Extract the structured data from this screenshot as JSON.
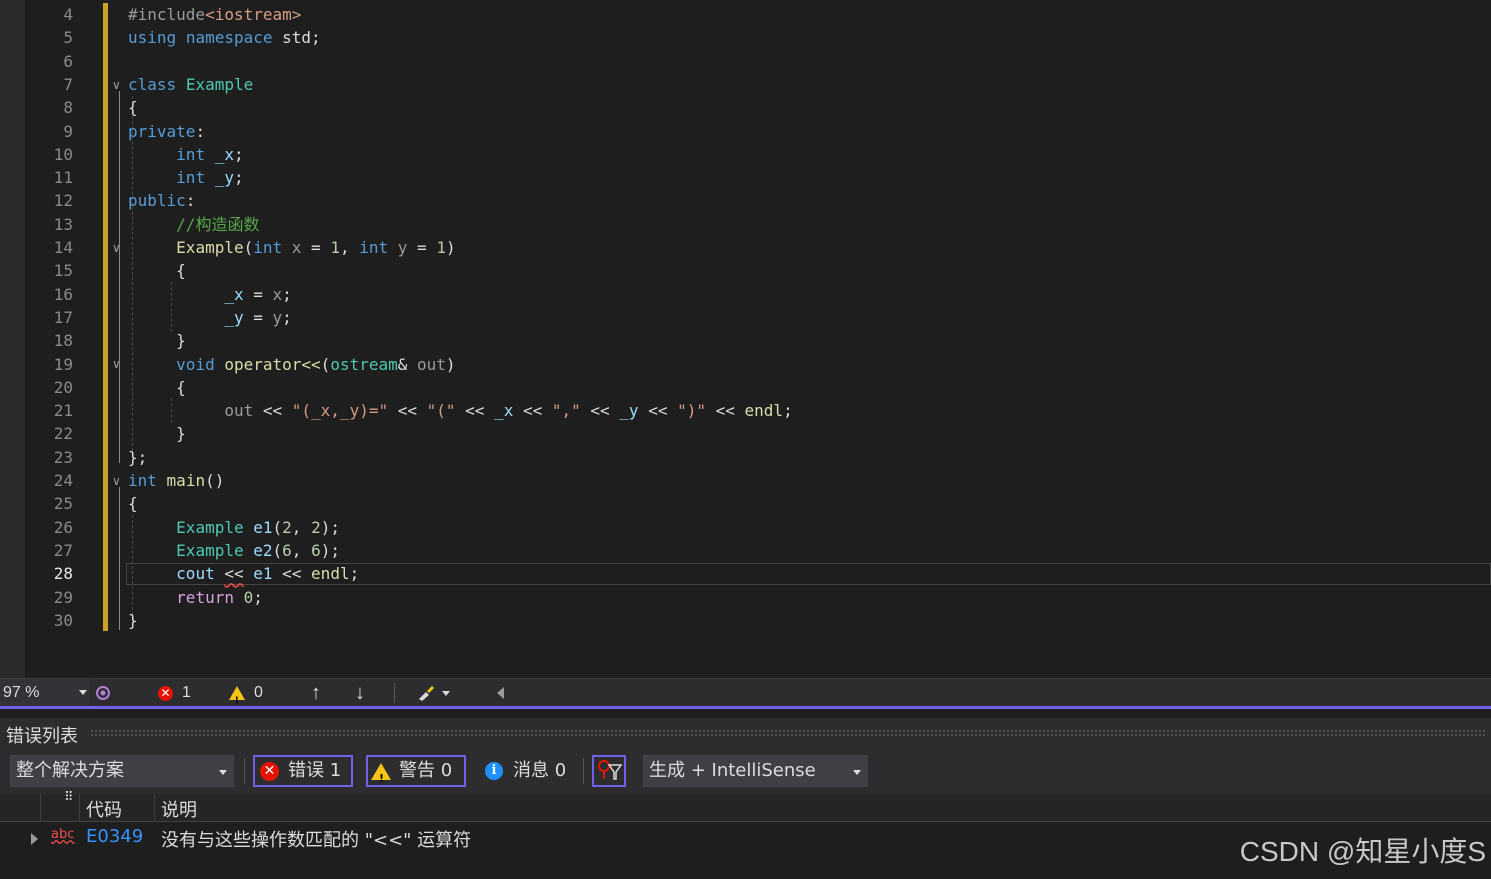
{
  "editor": {
    "lines": [
      {
        "n": "4",
        "tokens": [
          [
            "pp",
            "#include"
          ],
          [
            "incl",
            "<iostream>"
          ]
        ]
      },
      {
        "n": "5",
        "tokens": [
          [
            "kw",
            "using"
          ],
          [
            "",
            "",
            " "
          ],
          [
            "kw",
            "namespace"
          ],
          [
            "",
            " std;"
          ]
        ]
      },
      {
        "n": "6",
        "tokens": []
      },
      {
        "n": "7",
        "tokens": [
          [
            "kw",
            "class"
          ],
          [
            "",
            " "
          ],
          [
            "ty",
            "Example"
          ]
        ]
      },
      {
        "n": "8",
        "tokens": [
          [
            "",
            "{"
          ]
        ]
      },
      {
        "n": "9",
        "tokens": [
          [
            "kw",
            "private"
          ],
          [
            "",
            ":"
          ]
        ]
      },
      {
        "n": "10",
        "tokens": [
          [
            "",
            "     "
          ],
          [
            "kw",
            "int"
          ],
          [
            "var",
            " _x"
          ],
          [
            "",
            ";"
          ]
        ]
      },
      {
        "n": "11",
        "tokens": [
          [
            "",
            "     "
          ],
          [
            "kw",
            "int"
          ],
          [
            "var",
            " _y"
          ],
          [
            "",
            ";"
          ]
        ]
      },
      {
        "n": "12",
        "tokens": [
          [
            "kw",
            "public"
          ],
          [
            "",
            ":"
          ]
        ]
      },
      {
        "n": "13",
        "tokens": [
          [
            "",
            "     "
          ],
          [
            "cm",
            "//构造函数"
          ]
        ]
      },
      {
        "n": "14",
        "tokens": [
          [
            "",
            "     "
          ],
          [
            "fn",
            "Example"
          ],
          [
            "",
            "("
          ],
          [
            "kw",
            "int"
          ],
          [
            "param",
            " x"
          ],
          [
            "",
            " = "
          ],
          [
            "num",
            "1"
          ],
          [
            "",
            ", "
          ],
          [
            "kw",
            "int"
          ],
          [
            "param",
            " y"
          ],
          [
            "",
            " = "
          ],
          [
            "num",
            "1"
          ],
          [
            "",
            ")"
          ]
        ]
      },
      {
        "n": "15",
        "tokens": [
          [
            "",
            "     {"
          ]
        ]
      },
      {
        "n": "16",
        "tokens": [
          [
            "",
            "          "
          ],
          [
            "var",
            "_x"
          ],
          [
            "",
            " = "
          ],
          [
            "param",
            "x"
          ],
          [
            "",
            ";"
          ]
        ]
      },
      {
        "n": "17",
        "tokens": [
          [
            "",
            "          "
          ],
          [
            "var",
            "_y"
          ],
          [
            "",
            " = "
          ],
          [
            "param",
            "y"
          ],
          [
            "",
            ";"
          ]
        ]
      },
      {
        "n": "18",
        "tokens": [
          [
            "",
            "     }"
          ]
        ]
      },
      {
        "n": "19",
        "tokens": [
          [
            "",
            "     "
          ],
          [
            "kw",
            "void"
          ],
          [
            "",
            " "
          ],
          [
            "fn",
            "operator<<"
          ],
          [
            "",
            "("
          ],
          [
            "ty",
            "ostream"
          ],
          [
            "",
            "& "
          ],
          [
            "param",
            "out"
          ],
          [
            "",
            ")"
          ]
        ]
      },
      {
        "n": "20",
        "tokens": [
          [
            "",
            "     {"
          ]
        ]
      },
      {
        "n": "21",
        "tokens": [
          [
            "",
            "          "
          ],
          [
            "param",
            "out"
          ],
          [
            "",
            " << "
          ],
          [
            "str",
            "\"(_x,_y)=\""
          ],
          [
            "",
            " << "
          ],
          [
            "str",
            "\"(\""
          ],
          [
            "",
            " << "
          ],
          [
            "var",
            "_x"
          ],
          [
            "",
            " << "
          ],
          [
            "str",
            "\",\""
          ],
          [
            "",
            " << "
          ],
          [
            "var",
            "_y"
          ],
          [
            "",
            " << "
          ],
          [
            "str",
            "\")\""
          ],
          [
            "",
            " << "
          ],
          [
            "fn",
            "endl"
          ],
          [
            "",
            ";"
          ]
        ]
      },
      {
        "n": "22",
        "tokens": [
          [
            "",
            "     }"
          ]
        ]
      },
      {
        "n": "23",
        "tokens": [
          [
            "",
            "};"
          ]
        ]
      },
      {
        "n": "24",
        "tokens": [
          [
            "kw",
            "int"
          ],
          [
            "",
            " "
          ],
          [
            "fn",
            "main"
          ],
          [
            "",
            "()"
          ]
        ]
      },
      {
        "n": "25",
        "tokens": [
          [
            "",
            "{"
          ]
        ]
      },
      {
        "n": "26",
        "tokens": [
          [
            "",
            "     "
          ],
          [
            "ty",
            "Example"
          ],
          [
            "",
            " "
          ],
          [
            "var",
            "e1"
          ],
          [
            "",
            "("
          ],
          [
            "num",
            "2"
          ],
          [
            "",
            ", "
          ],
          [
            "num",
            "2"
          ],
          [
            "",
            ");"
          ]
        ]
      },
      {
        "n": "27",
        "tokens": [
          [
            "",
            "     "
          ],
          [
            "ty",
            "Example"
          ],
          [
            "",
            " "
          ],
          [
            "var",
            "e2"
          ],
          [
            "",
            "("
          ],
          [
            "num",
            "6"
          ],
          [
            "",
            ", "
          ],
          [
            "num",
            "6"
          ],
          [
            "",
            ");"
          ]
        ]
      },
      {
        "n": "28",
        "tokens": [
          [
            "",
            "     "
          ],
          [
            "var",
            "cout"
          ],
          [
            "",
            " "
          ],
          [
            "squig",
            "<<"
          ],
          [
            "",
            " "
          ],
          [
            "var",
            "e1"
          ],
          [
            "",
            " << "
          ],
          [
            "fn",
            "endl"
          ],
          [
            "",
            ";"
          ]
        ]
      },
      {
        "n": "29",
        "tokens": [
          [
            "",
            "     "
          ],
          [
            "ctl",
            "return"
          ],
          [
            "",
            " "
          ],
          [
            "num",
            "0"
          ],
          [
            "",
            ";"
          ]
        ]
      },
      {
        "n": "30",
        "tokens": [
          [
            "",
            "}"
          ]
        ]
      }
    ],
    "current_line": "28"
  },
  "status_bar": {
    "zoom": "97 %",
    "error_count": "1",
    "warning_count": "0",
    "up_arrow": "↑",
    "down_arrow": "↓",
    "brush_icon": "brush-icon"
  },
  "error_list": {
    "title": "错误列表",
    "scope": "整个解决方案",
    "errors_label": "错误 1",
    "warnings_label": "警告 0",
    "messages_label": "消息 0",
    "source": "生成 + IntelliSense",
    "columns": {
      "code": "代码",
      "description": "说明"
    },
    "rows": [
      {
        "type_icon": "abc",
        "code": "E0349",
        "description": "没有与这些操作数匹配的 \"<<\" 运算符"
      }
    ]
  },
  "watermark": "CSDN @知星小度S",
  "colors": {
    "accent": "#7160e8",
    "error": "#e51400",
    "warning": "#f5c518",
    "change_bar": "#c9a227"
  }
}
